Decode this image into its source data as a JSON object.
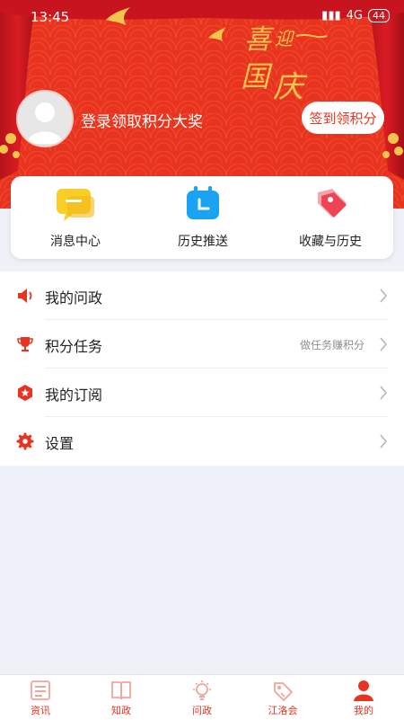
{
  "status_bar": {
    "time": "13:45",
    "network": "4G",
    "battery": "44"
  },
  "header": {
    "banner_text": "喜迎国庆",
    "login_text": "登录领取积分大奖",
    "signin_button": "签到领积分"
  },
  "quick_actions": [
    {
      "label": "消息中心",
      "icon": "message-icon"
    },
    {
      "label": "历史推送",
      "icon": "calendar-icon"
    },
    {
      "label": "收藏与历史",
      "icon": "tag-icon"
    }
  ],
  "menu": [
    {
      "label": "我的问政",
      "hint": "",
      "icon": "speaker-icon"
    },
    {
      "label": "积分任务",
      "hint": "做任务赚积分",
      "icon": "trophy-icon"
    },
    {
      "label": "我的订阅",
      "hint": "",
      "icon": "star-badge-icon"
    },
    {
      "label": "设置",
      "hint": "",
      "icon": "gear-icon"
    }
  ],
  "tabs": [
    {
      "label": "资讯",
      "icon": "news-icon"
    },
    {
      "label": "知政",
      "icon": "book-icon"
    },
    {
      "label": "问政",
      "icon": "bulb-icon"
    },
    {
      "label": "江洛会",
      "icon": "tag-icon"
    },
    {
      "label": "我的",
      "icon": "person-icon",
      "active": true
    }
  ],
  "colors": {
    "primary": "#e8341f",
    "background": "#eef1f7",
    "gold": "#f3c44e"
  }
}
